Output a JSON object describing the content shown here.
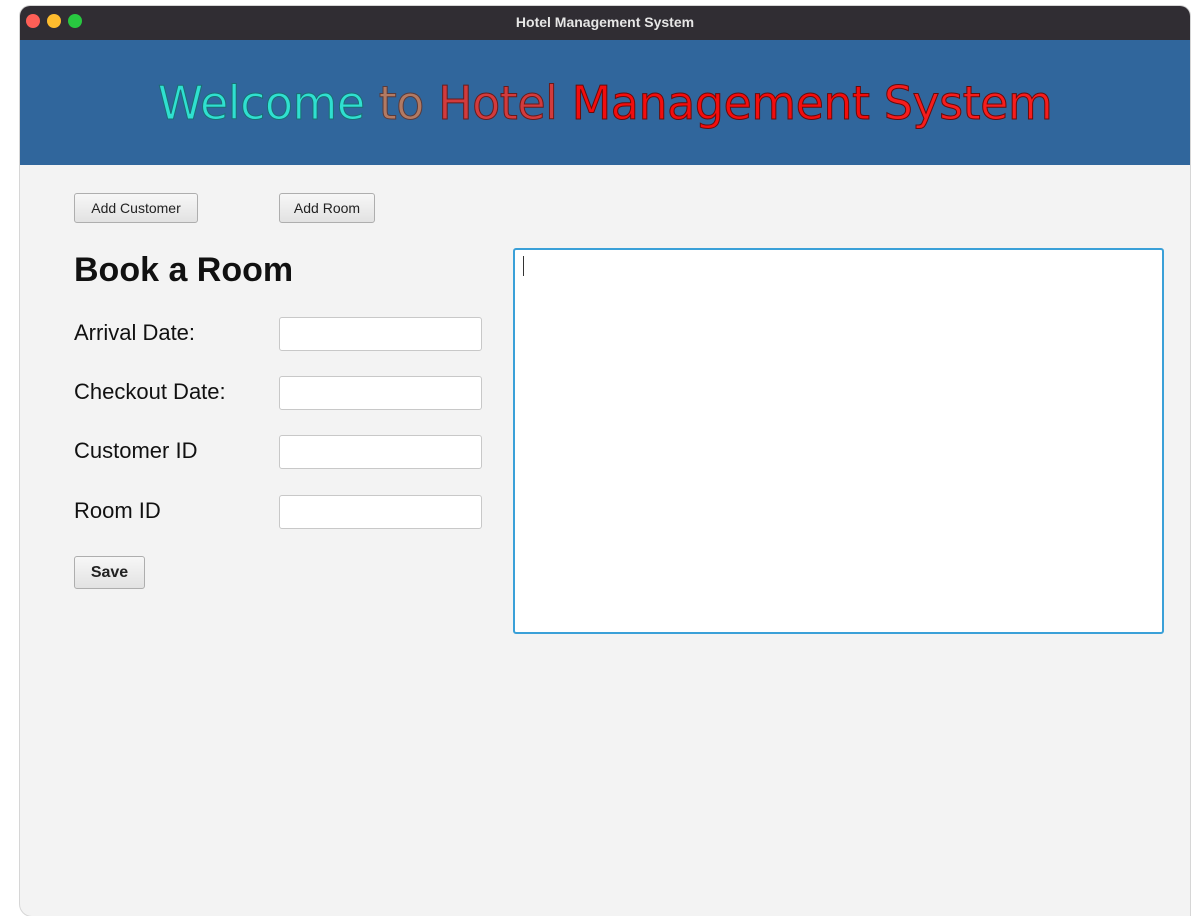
{
  "window": {
    "title": "Hotel Management System"
  },
  "banner": {
    "word1": "Welcome",
    "word2": "to",
    "word3": "Hotel",
    "word4": "Management",
    "word5": "System"
  },
  "toolbar": {
    "add_customer_label": "Add Customer",
    "add_room_label": "Add Room"
  },
  "form": {
    "heading": "Book a Room",
    "arrival_label": "Arrival Date:",
    "arrival_value": "",
    "checkout_label": "Checkout Date:",
    "checkout_value": "",
    "customer_label": "Customer ID",
    "customer_value": "",
    "room_label": "Room ID",
    "room_value": "",
    "save_label": "Save"
  },
  "output": {
    "text": ""
  },
  "colors": {
    "titlebar": "#302d33",
    "banner": "#30669c",
    "focus_border": "#3aa0d8"
  }
}
